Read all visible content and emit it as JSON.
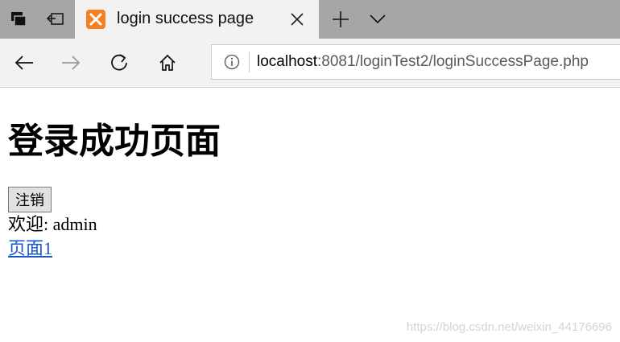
{
  "tab": {
    "title": "login success page",
    "favicon": "xampp-icon"
  },
  "address_bar": {
    "url_host": "localhost",
    "url_rest": ":8081/loginTest2/loginSuccessPage.php"
  },
  "page": {
    "heading": "登录成功页面",
    "logout_label": "注销",
    "welcome_label": "欢迎:",
    "username": "admin",
    "link_label": "页面1"
  },
  "watermark": "https://blog.csdn.net/weixin_44176696",
  "colors": {
    "tabstrip": "#a6a6a6",
    "toolbar": "#f2f2f2",
    "favicon": "#f58220",
    "link": "#1a56c8"
  }
}
